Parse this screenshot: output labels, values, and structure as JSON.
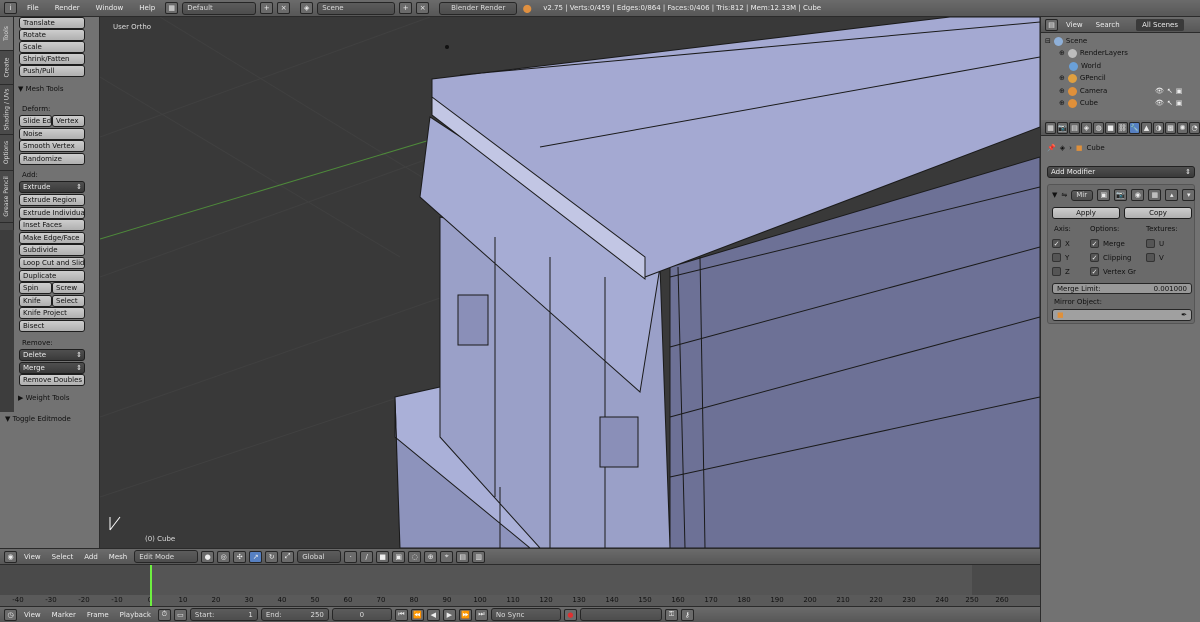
{
  "topbar": {
    "menus": [
      "File",
      "Render",
      "Window",
      "Help"
    ],
    "screen_layout": "Default",
    "scene": "Scene",
    "engine": "Blender Render",
    "stats": "v2.75 | Verts:0/459 | Edges:0/864 | Faces:0/406 | Tris:812 | Mem:12.33M | Cube"
  },
  "tooltabs": [
    "Tools",
    "Create",
    "Shading / UVs",
    "Options",
    "Grease Pencil"
  ],
  "toolpanel": {
    "transform_buttons": [
      "Translate",
      "Rotate",
      "Scale",
      "Shrink/Fatten",
      "Push/Pull"
    ],
    "mesh_tools_header": "Mesh Tools",
    "deform_label": "Deform:",
    "slide_edge": "Slide Ed",
    "vertex": "Vertex",
    "noise": "Noise",
    "smooth_vertex": "Smooth Vertex",
    "randomize": "Randomize",
    "add_label": "Add:",
    "extrude": "Extrude",
    "extrude_region": "Extrude Region",
    "extrude_individual": "Extrude Individual",
    "inset_faces": "Inset Faces",
    "make_edge_face": "Make Edge/Face",
    "subdivide": "Subdivide",
    "loop_cut": "Loop Cut and Slide",
    "duplicate": "Duplicate",
    "spin": "Spin",
    "screw": "Screw",
    "knife": "Knife",
    "select": "Select",
    "knife_project": "Knife Project",
    "bisect": "Bisect",
    "remove_label": "Remove:",
    "delete": "Delete",
    "merge": "Merge",
    "remove_doubles": "Remove Doubles",
    "weight_tools_header": "Weight Tools",
    "toggle_editmode": "Toggle Editmode"
  },
  "viewport": {
    "label": "User Ortho",
    "object_label": "(0) Cube"
  },
  "view_header": {
    "menus": [
      "View",
      "Select",
      "Add",
      "Mesh"
    ],
    "mode": "Edit Mode",
    "orientation": "Global"
  },
  "timeline": {
    "ticks": [
      "-40",
      "-30",
      "-20",
      "-10",
      "0",
      "10",
      "20",
      "30",
      "40",
      "50",
      "60",
      "70",
      "80",
      "90",
      "100",
      "110",
      "120",
      "130",
      "140",
      "150",
      "160",
      "170",
      "180",
      "190",
      "200",
      "210",
      "220",
      "230",
      "240",
      "250",
      "260"
    ],
    "current_frame": "0"
  },
  "bottombar": {
    "menus": [
      "View",
      "Marker",
      "Frame",
      "Playback"
    ],
    "start_label": "Start:",
    "start_value": "1",
    "end_label": "End:",
    "end_value": "250",
    "frame_value": "0",
    "sync": "No Sync"
  },
  "outliner": {
    "menus": [
      "View",
      "Search"
    ],
    "filter": "All Scenes",
    "items": [
      {
        "name": "Scene",
        "color": "#8fb0d8"
      },
      {
        "name": "RenderLayers",
        "color": "#bdbdbd"
      },
      {
        "name": "World",
        "color": "#6aa0d8"
      },
      {
        "name": "GPencil",
        "color": "#e0a040"
      },
      {
        "name": "Camera",
        "color": "#e0903a"
      },
      {
        "name": "Cube",
        "color": "#e0903a"
      }
    ]
  },
  "properties": {
    "object_name": "Cube",
    "add_modifier": "Add Modifier",
    "modifier_name": "Mir",
    "apply": "Apply",
    "copy": "Copy",
    "axis_label": "Axis:",
    "options_label": "Options:",
    "textures_label": "Textures:",
    "axis": [
      "X",
      "Y",
      "Z"
    ],
    "options": [
      "Merge",
      "Clipping",
      "Vertex Gr"
    ],
    "textures": [
      "U",
      "V"
    ],
    "merge_limit_label": "Merge Limit:",
    "merge_limit_value": "0.001000",
    "mirror_object_label": "Mirror Object:"
  }
}
